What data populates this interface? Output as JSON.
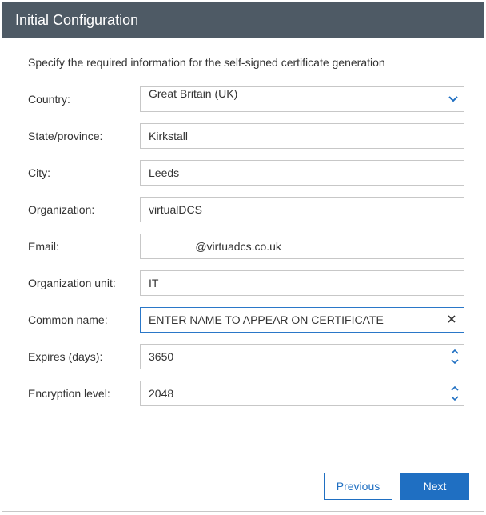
{
  "header": {
    "title": "Initial Configuration"
  },
  "instruction": "Specify the required information for the self-signed certificate generation",
  "form": {
    "country": {
      "label": "Country:",
      "value": "Great Britain (UK)"
    },
    "state": {
      "label": "State/province:",
      "value": "Kirkstall"
    },
    "city": {
      "label": "City:",
      "value": "Leeds"
    },
    "organization": {
      "label": "Organization:",
      "value": "virtualDCS"
    },
    "email": {
      "label": "Email:",
      "value": "               @virtuadcs.co.uk"
    },
    "org_unit": {
      "label": "Organization unit:",
      "value": "IT"
    },
    "common_name": {
      "label": "Common name:",
      "value": "ENTER NAME TO APPEAR ON CERTIFICATE"
    },
    "expires": {
      "label": "Expires (days):",
      "value": "3650"
    },
    "encryption": {
      "label": "Encryption level:",
      "value": "2048"
    }
  },
  "footer": {
    "previous": "Previous",
    "next": "Next"
  }
}
